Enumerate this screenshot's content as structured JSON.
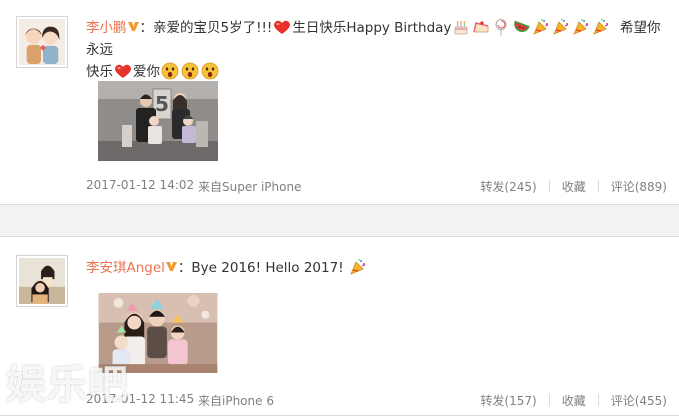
{
  "posts": [
    {
      "username": "李小鹏",
      "text_part1": "：亲爱的宝贝5岁了!!!",
      "text_part2": "生日快乐Happy Birthday",
      "text_part3": "希望你永远",
      "text_part4": "快乐",
      "text_part5": "爱你",
      "time": "2017-01-12 14:02",
      "source": "来自Super iPhone",
      "repost": "转发(245)",
      "favorite": "收藏",
      "comment": "评论(889)"
    },
    {
      "username": "李安琪Angel",
      "text_part1": "：Bye 2016! Hello 2017!",
      "time": "2017-01-12 11:45",
      "source": "来自iPhone 6",
      "repost": "转发(157)",
      "favorite": "收藏",
      "comment": "评论(455)"
    }
  ],
  "icons": {
    "verified_badge": "vip-v-icon",
    "heart": "red-heart-emoji",
    "cake": "cake-emoji",
    "cake_slice": "cake-slice-emoji",
    "lollipop": "lollipop-emoji",
    "watermelon": "watermelon-emoji",
    "party": "party-popper-emoji",
    "surprised": "surprised-face-emoji"
  },
  "colors": {
    "username": "#eb7350",
    "meta": "#808080",
    "text": "#333333"
  },
  "watermark": "娱乐吧"
}
